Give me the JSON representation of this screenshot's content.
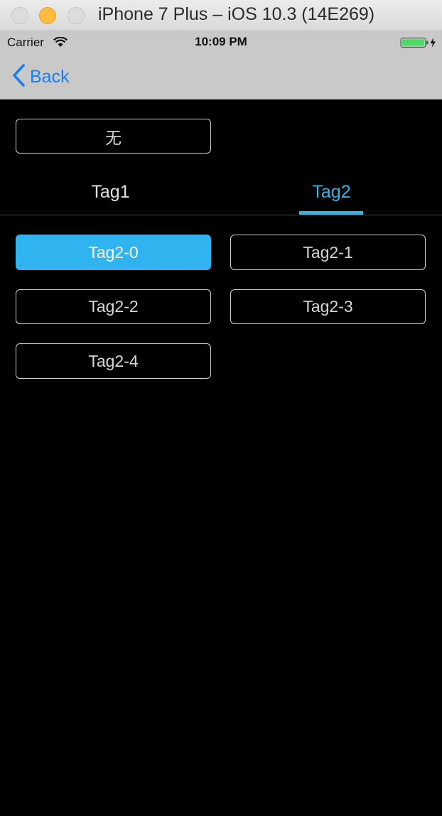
{
  "window": {
    "title": "iPhone 7 Plus – iOS 10.3 (14E269)"
  },
  "status_bar": {
    "carrier": "Carrier",
    "time": "10:09 PM",
    "battery_color": "#4cd964"
  },
  "nav_bar": {
    "back_label": "Back",
    "tint_color": "#1a7ff0"
  },
  "filter": {
    "none_label": "无"
  },
  "tabs": [
    {
      "label": "Tag1",
      "active": false
    },
    {
      "label": "Tag2",
      "active": true
    }
  ],
  "tag_buttons": [
    {
      "label": "Tag2-0",
      "selected": true
    },
    {
      "label": "Tag2-1",
      "selected": false
    },
    {
      "label": "Tag2-2",
      "selected": false
    },
    {
      "label": "Tag2-3",
      "selected": false
    },
    {
      "label": "Tag2-4",
      "selected": false
    }
  ],
  "colors": {
    "accent": "#30b4ef",
    "background": "#000000"
  }
}
